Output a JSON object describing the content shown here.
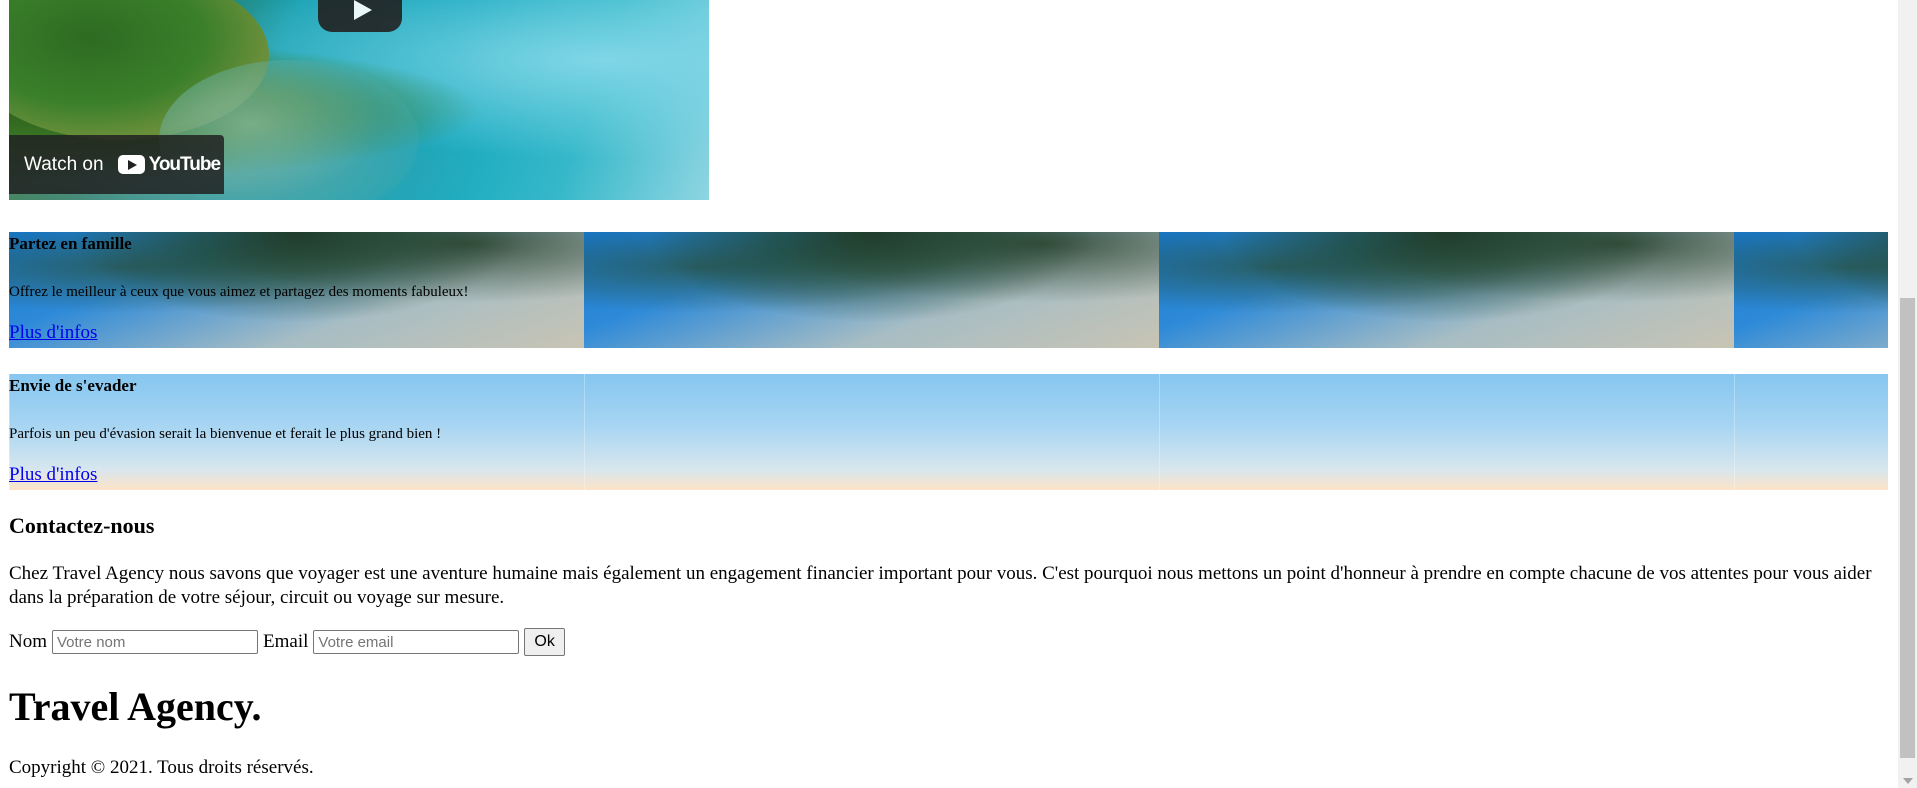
{
  "video": {
    "watch_on_label": "Watch on",
    "youtube_label": "YouTube"
  },
  "sections": [
    {
      "title": "Partez en famille",
      "description": "Offrez le meilleur à ceux que vous aimez et partagez des moments fabuleux!",
      "link_label": "Plus d'infos"
    },
    {
      "title": "Envie de s'evader",
      "description": "Parfois un peu d'évasion serait la bienvenue et ferait le plus grand bien !",
      "link_label": "Plus d'infos"
    }
  ],
  "contact": {
    "heading": "Contactez-nous",
    "text": "Chez Travel Agency nous savons que voyager est une aventure humaine mais également un engagement financier important pour vous. C'est pourquoi nous mettons un point d'honneur à prendre en compte chacune de vos attentes pour vous aider dans la préparation de votre séjour, circuit ou voyage sur mesure.",
    "name_label": "Nom",
    "name_placeholder": "Votre nom",
    "name_value": "",
    "email_label": "Email",
    "email_placeholder": "Votre email",
    "email_value": "",
    "submit_label": "Ok"
  },
  "footer": {
    "brand": "Travel Agency.",
    "copyright": "Copyright © 2021. Tous droits réservés."
  },
  "icons": {
    "play": "play-icon",
    "youtube": "youtube-logo-icon",
    "scroll_down": "scroll-down-arrow-icon"
  }
}
